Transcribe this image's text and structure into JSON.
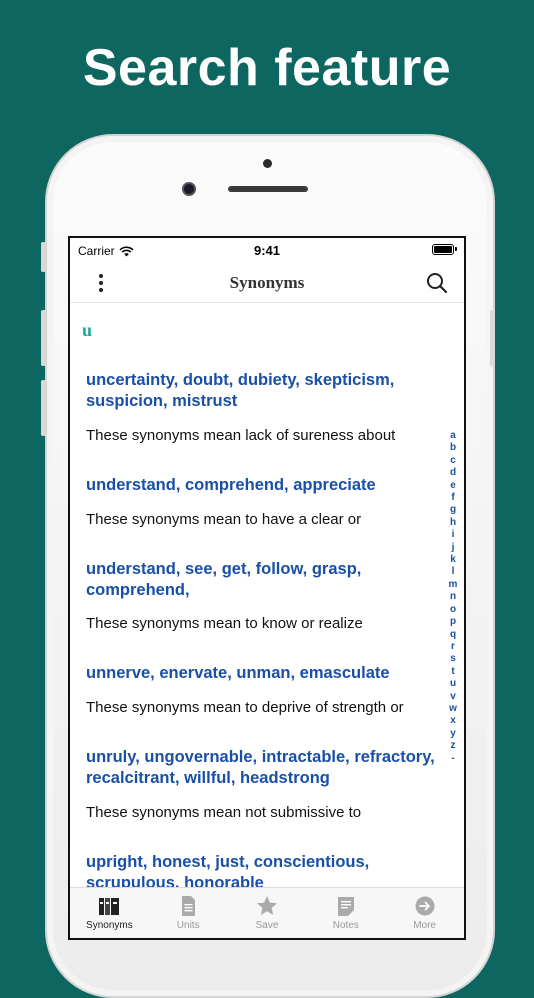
{
  "headline": "Search feature",
  "status_bar": {
    "carrier": "Carrier",
    "time": "9:41"
  },
  "nav": {
    "title": "Synonyms"
  },
  "section_letter": "u",
  "entries": [
    {
      "title": "uncertainty, doubt, dubiety, skepticism, suspicion, mistrust",
      "description": "These synonyms mean lack of sureness about"
    },
    {
      "title": "understand, comprehend, appreciate",
      "description": "These synonyms mean to have a clear or"
    },
    {
      "title": "understand, see, get, follow, grasp, comprehend,",
      "description": "These synonyms mean to know or realize"
    },
    {
      "title": "unnerve, enervate, unman, emasculate",
      "description": "These synonyms mean to deprive of strength or"
    },
    {
      "title": "unruly, ungovernable, intractable, refractory, recalcitrant, willful, headstrong",
      "description": "These synonyms mean not submissive to"
    },
    {
      "title": "upright, honest, just, conscientious, scrupulous, honorable",
      "description": ""
    }
  ],
  "index_letters": [
    "a",
    "b",
    "c",
    "d",
    "e",
    "f",
    "g",
    "h",
    "i",
    "j",
    "k",
    "l",
    "m",
    "n",
    "o",
    "p",
    "q",
    "r",
    "s",
    "t",
    "u",
    "v",
    "w",
    "x",
    "y",
    "z",
    "-"
  ],
  "tabs": [
    {
      "label": "Synonyms",
      "icon": "books-icon",
      "active": true
    },
    {
      "label": "Units",
      "icon": "document-icon",
      "active": false
    },
    {
      "label": "Save",
      "icon": "star-icon",
      "active": false
    },
    {
      "label": "Notes",
      "icon": "notes-icon",
      "active": false
    },
    {
      "label": "More",
      "icon": "arrow-circle-icon",
      "active": false
    }
  ],
  "colors": {
    "background": "#0d6660",
    "accent_link": "#1a4fa8",
    "section_letter": "#1aa89c"
  }
}
